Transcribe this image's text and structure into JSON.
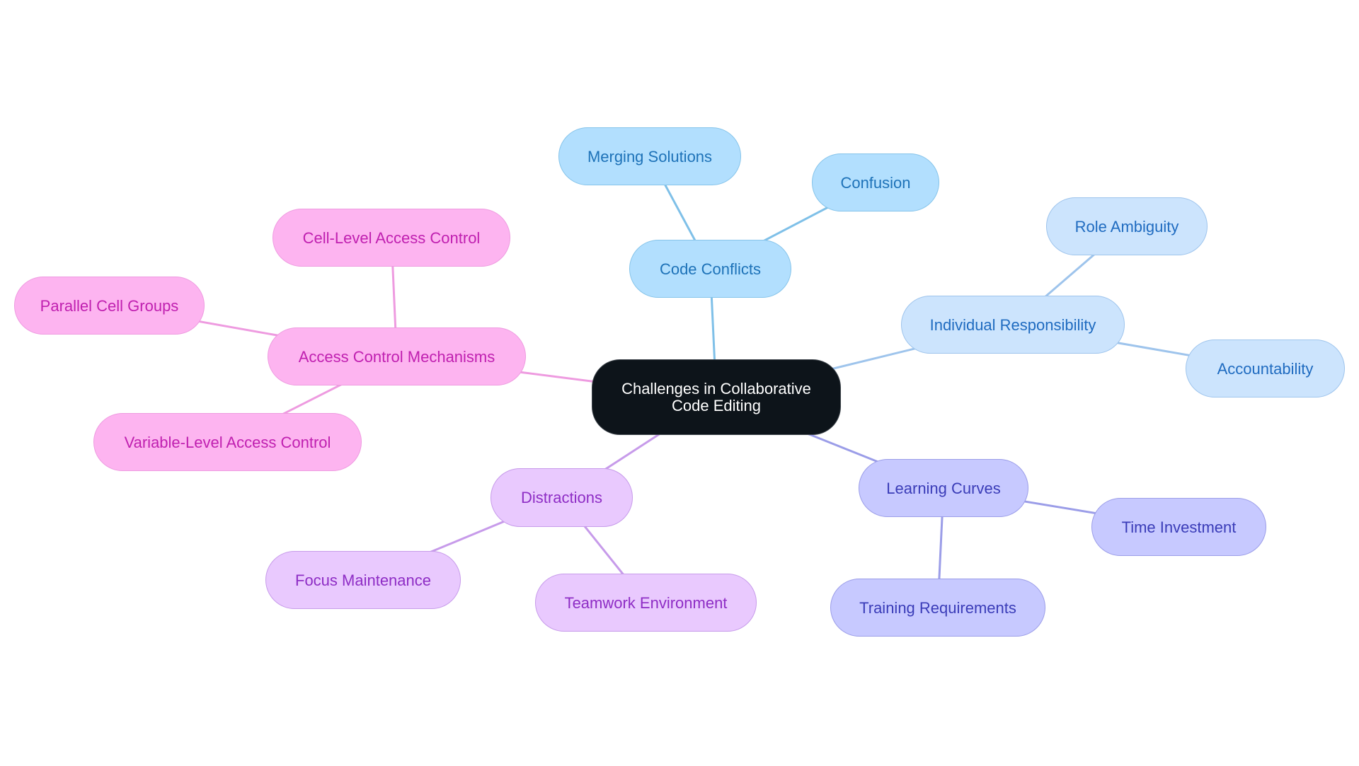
{
  "diagram": {
    "type": "mind-map",
    "root": {
      "id": "root",
      "label": "Challenges in Collaborative\nCode Editing"
    },
    "branches": [
      {
        "id": "code",
        "label": "Code Conflicts",
        "color_group": "g-code",
        "children": [
          {
            "id": "merging",
            "label": "Merging Solutions"
          },
          {
            "id": "confusion",
            "label": "Confusion"
          }
        ]
      },
      {
        "id": "resp",
        "label": "Individual Responsibility",
        "color_group": "g-resp",
        "children": [
          {
            "id": "role",
            "label": "Role Ambiguity"
          },
          {
            "id": "account",
            "label": "Accountability"
          }
        ]
      },
      {
        "id": "learn",
        "label": "Learning Curves",
        "color_group": "g-learn",
        "children": [
          {
            "id": "time",
            "label": "Time Investment"
          },
          {
            "id": "training",
            "label": "Training Requirements"
          }
        ]
      },
      {
        "id": "dist",
        "label": "Distractions",
        "color_group": "g-dist",
        "children": [
          {
            "id": "focus",
            "label": "Focus Maintenance"
          },
          {
            "id": "teamwork",
            "label": "Teamwork Environment"
          }
        ]
      },
      {
        "id": "access",
        "label": "Access Control Mechanisms",
        "color_group": "g-access",
        "children": [
          {
            "id": "cell",
            "label": "Cell-Level Access Control"
          },
          {
            "id": "parallel",
            "label": "Parallel Cell Groups"
          },
          {
            "id": "variable",
            "label": "Variable-Level Access Control"
          }
        ]
      }
    ],
    "edge_colors": {
      "g-code": "#7fc0e8",
      "g-resp": "#9ec4ec",
      "g-learn": "#9b9de8",
      "g-dist": "#c79bea",
      "g-access": "#ee9be0"
    }
  }
}
